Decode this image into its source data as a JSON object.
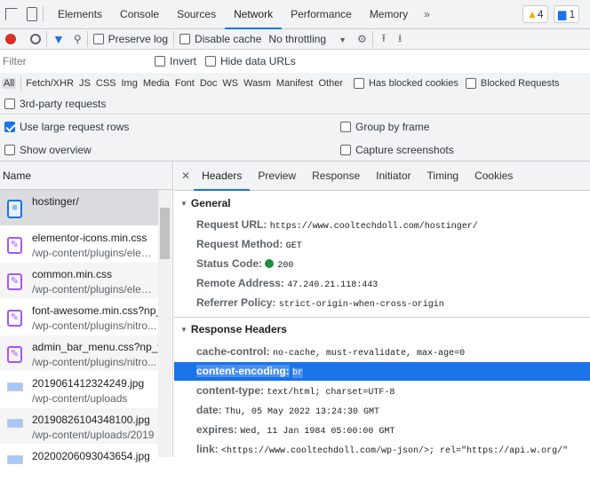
{
  "topbar": {
    "tabs": [
      "Elements",
      "Console",
      "Sources",
      "Network",
      "Performance",
      "Memory"
    ],
    "active": "Network",
    "more": "»",
    "warnings": "4",
    "messages": "1"
  },
  "toolbar": {
    "preserve_log": "Preserve log",
    "disable_cache": "Disable cache",
    "throttling": "No throttling"
  },
  "filter": {
    "placeholder": "Filter",
    "invert": "Invert",
    "hide_data_urls": "Hide data URLs",
    "types": [
      "All",
      "Fetch/XHR",
      "JS",
      "CSS",
      "Img",
      "Media",
      "Font",
      "Doc",
      "WS",
      "Wasm",
      "Manifest",
      "Other"
    ],
    "has_blocked_cookies": "Has blocked cookies",
    "blocked_requests": "Blocked Requests",
    "third_party": "3rd-party requests"
  },
  "settings": {
    "large_rows": "Use large request rows",
    "large_rows_checked": true,
    "overview": "Show overview",
    "group_by_frame": "Group by frame",
    "capture_screenshots": "Capture screenshots"
  },
  "requests": {
    "header": "Name",
    "items": [
      {
        "name": "hostinger/",
        "path": "",
        "type": "doc"
      },
      {
        "name": "elementor-icons.min.css",
        "path": "/wp-content/plugins/elem...",
        "type": "css"
      },
      {
        "name": "common.min.css",
        "path": "/wp-content/plugins/elem...",
        "type": "css"
      },
      {
        "name": "font-awesome.min.css?np_",
        "path": "/wp-content/plugins/nitro...",
        "type": "css"
      },
      {
        "name": "admin_bar_menu.css?np_v...",
        "path": "/wp-content/plugins/nitro...",
        "type": "css"
      },
      {
        "name": "2019061412324249.jpg",
        "path": "/wp-content/uploads",
        "type": "img"
      },
      {
        "name": "20190826104348100.jpg",
        "path": "/wp-content/uploads/2019",
        "type": "img"
      },
      {
        "name": "20200206093043654.jpg",
        "path": "",
        "type": "img"
      }
    ]
  },
  "details": {
    "tabs": [
      "Headers",
      "Preview",
      "Response",
      "Initiator",
      "Timing",
      "Cookies"
    ],
    "active": "Headers",
    "general_title": "General",
    "general": [
      {
        "k": "Request URL:",
        "v": "https://www.cooltechdoll.com/hostinger/"
      },
      {
        "k": "Request Method:",
        "v": "GET"
      },
      {
        "k": "Status Code:",
        "v": "200",
        "status_color": "#1e8e3e"
      },
      {
        "k": "Remote Address:",
        "v": "47.240.21.118:443"
      },
      {
        "k": "Referrer Policy:",
        "v": "strict-origin-when-cross-origin"
      }
    ],
    "response_title": "Response Headers",
    "response": [
      {
        "k": "cache-control:",
        "v": "no-cache, must-revalidate, max-age=0"
      },
      {
        "k": "content-encoding:",
        "v": "br",
        "selected": true
      },
      {
        "k": "content-type:",
        "v": "text/html; charset=UTF-8"
      },
      {
        "k": "date:",
        "v": "Thu, 05 May 2022 13:24:30 GMT"
      },
      {
        "k": "expires:",
        "v": "Wed, 11 Jan 1984 05:00:00 GMT"
      },
      {
        "k": "link:",
        "v": "<https://www.cooltechdoll.com/wp-json/>; rel=\"https://api.w.org/\""
      }
    ]
  }
}
